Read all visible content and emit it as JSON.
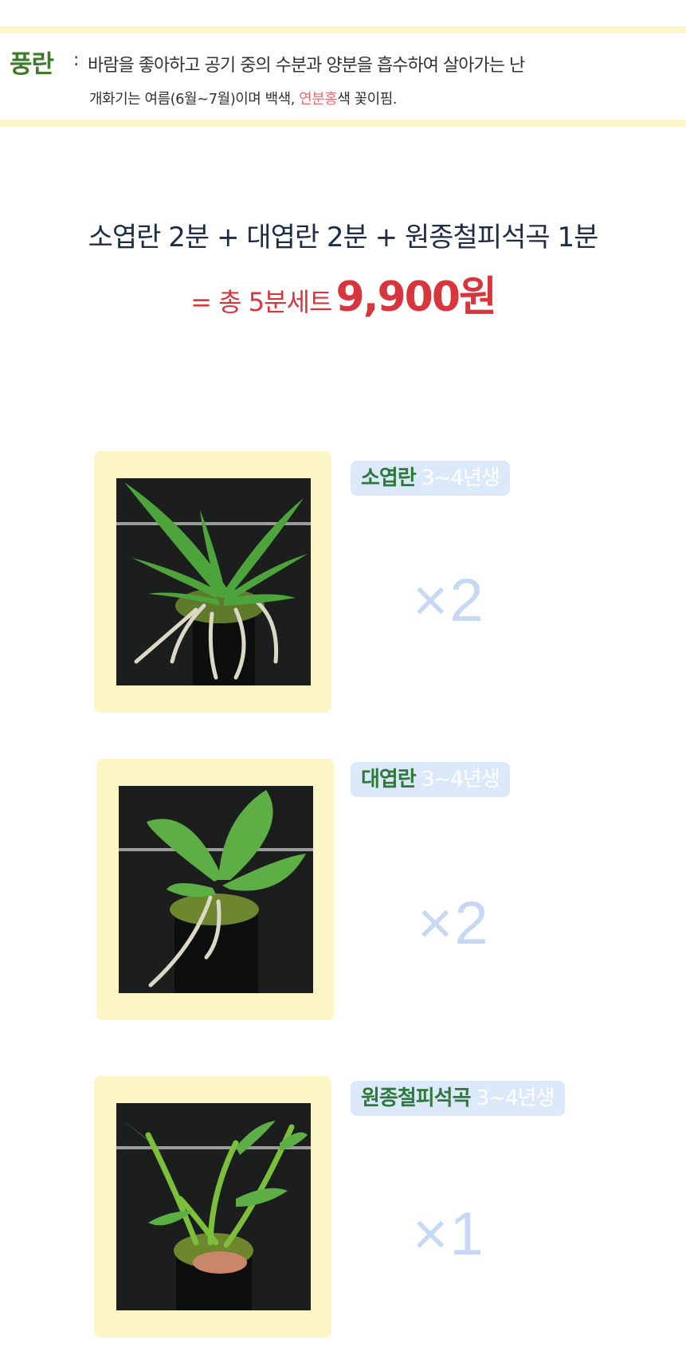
{
  "intro": {
    "name": "풍란",
    "colon": ":",
    "line1": "바람을 좋아하고 공기 중의 수분과 양분을 흡수하여 살아가는 난",
    "line2_before": "개화기는 여름(6월~7월)이며 백색, ",
    "line2_highlight": "연분홍",
    "line2_after": "색 꽃이핌."
  },
  "set": {
    "composition": "소엽란 2분 + 대엽란 2분 + 원종철피석곡 1분",
    "total_prefix": "= 총 5분세트",
    "price": "9,900원"
  },
  "products": [
    {
      "name": "소엽란",
      "age": "3~4년생",
      "quantity": "×2"
    },
    {
      "name": "대엽란",
      "age": "3~4년생",
      "quantity": "×2"
    },
    {
      "name": "원종철피석곡",
      "age": "3~4년생",
      "quantity": "×1"
    }
  ],
  "colors": {
    "band": "#fbf5c8",
    "intro_name": "#3f7a2d",
    "highlight": "#f06a74",
    "price": "#d9353d",
    "frame": "#fcf6c6",
    "label_bg": "#dce9fb",
    "product_name": "#2f7a3b",
    "quantity": "#c6d8f4"
  },
  "icons": [
    "orchid-photo-small-leaf",
    "orchid-photo-large-leaf",
    "orchid-photo-dendrobium"
  ]
}
